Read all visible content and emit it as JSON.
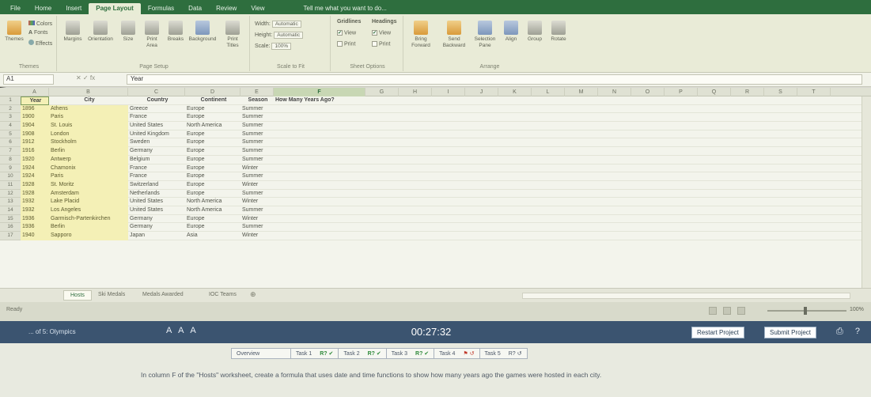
{
  "ribbon_tabs": [
    {
      "label": "File",
      "active": false
    },
    {
      "label": "Home",
      "active": false
    },
    {
      "label": "Insert",
      "active": false
    },
    {
      "label": "Page Layout",
      "active": true
    },
    {
      "label": "Formulas",
      "active": false
    },
    {
      "label": "Data",
      "active": false
    },
    {
      "label": "Review",
      "active": false
    },
    {
      "label": "View",
      "active": false
    }
  ],
  "tell_me": "Tell me what you want to do...",
  "ribbon": {
    "themes": {
      "themes_label": "Themes",
      "colors": "Colors",
      "fonts": "Fonts",
      "effects": "Effects",
      "group": "Themes"
    },
    "page_setup": {
      "margins": "Margins",
      "orientation": "Orientation",
      "size": "Size",
      "print_area": "Print Area",
      "breaks": "Breaks",
      "background": "Background",
      "print_titles": "Print Titles",
      "group": "Page Setup"
    },
    "scale": {
      "width_label": "Width:",
      "width_value": "Automatic",
      "height_label": "Height:",
      "height_value": "Automatic",
      "scale_label": "Scale:",
      "scale_value": "100%",
      "group": "Scale to Fit"
    },
    "sheet_options": {
      "gridlines": "Gridlines",
      "headings": "Headings",
      "view": "View",
      "print": "Print",
      "group": "Sheet Options"
    },
    "arrange": {
      "bring_forward": "Bring Forward",
      "send_backward": "Send Backward",
      "selection_pane": "Selection Pane",
      "align": "Align",
      "group_btn": "Group",
      "rotate": "Rotate",
      "group": "Arrange"
    }
  },
  "formula_bar": {
    "name_box": "A1",
    "content": "Year",
    "fx": "✕  ✓  fx"
  },
  "columns": [
    {
      "label": "A",
      "selected": false
    },
    {
      "label": "B",
      "selected": false
    },
    {
      "label": "C",
      "selected": false
    },
    {
      "label": "D",
      "selected": false
    },
    {
      "label": "E",
      "selected": false
    },
    {
      "label": "F",
      "selected": true
    },
    {
      "label": "G",
      "selected": false
    },
    {
      "label": "H",
      "selected": false
    },
    {
      "label": "I",
      "selected": false
    },
    {
      "label": "J",
      "selected": false
    },
    {
      "label": "K",
      "selected": false
    },
    {
      "label": "L",
      "selected": false
    },
    {
      "label": "M",
      "selected": false
    },
    {
      "label": "N",
      "selected": false
    },
    {
      "label": "O",
      "selected": false
    },
    {
      "label": "P",
      "selected": false
    },
    {
      "label": "Q",
      "selected": false
    },
    {
      "label": "R",
      "selected": false
    },
    {
      "label": "S",
      "selected": false
    },
    {
      "label": "T",
      "selected": false
    }
  ],
  "table": {
    "headers": [
      "Year",
      "City",
      "Country",
      "Continent",
      "Season",
      "How Many Years Ago?"
    ],
    "rows": [
      [
        "1896",
        "Athens",
        "Greece",
        "Europe",
        "Summer"
      ],
      [
        "1900",
        "Paris",
        "France",
        "Europe",
        "Summer"
      ],
      [
        "1904",
        "St. Louis",
        "United States",
        "North America",
        "Summer"
      ],
      [
        "1908",
        "London",
        "United Kingdom",
        "Europe",
        "Summer"
      ],
      [
        "1912",
        "Stockholm",
        "Sweden",
        "Europe",
        "Summer"
      ],
      [
        "1916",
        "Berlin",
        "Germany",
        "Europe",
        "Summer"
      ],
      [
        "1920",
        "Antwerp",
        "Belgium",
        "Europe",
        "Summer"
      ],
      [
        "1924",
        "Chamonix",
        "France",
        "Europe",
        "Winter"
      ],
      [
        "1924",
        "Paris",
        "France",
        "Europe",
        "Summer"
      ],
      [
        "1928",
        "St. Moritz",
        "Switzerland",
        "Europe",
        "Winter"
      ],
      [
        "1928",
        "Amsterdam",
        "Netherlands",
        "Europe",
        "Summer"
      ],
      [
        "1932",
        "Lake Placid",
        "United States",
        "North America",
        "Winter"
      ],
      [
        "1932",
        "Los Angeles",
        "United States",
        "North America",
        "Summer"
      ],
      [
        "1936",
        "Garmisch-Partenkirchen",
        "Germany",
        "Europe",
        "Winter"
      ],
      [
        "1936",
        "Berlin",
        "Germany",
        "Europe",
        "Summer"
      ],
      [
        "1940",
        "Sapporo",
        "Japan",
        "Asia",
        "Winter"
      ]
    ],
    "row_numbers": [
      "1",
      "2",
      "3",
      "4",
      "5",
      "6",
      "7",
      "8",
      "9",
      "10",
      "11",
      "12",
      "13",
      "14",
      "15",
      "16",
      "17"
    ]
  },
  "sheet_tabs": [
    {
      "label": "Hosts",
      "active": true
    },
    {
      "label": "Ski Medals",
      "active": false
    },
    {
      "label": "Medals Awarded",
      "active": false
    },
    {
      "label": "IOC Teams",
      "active": false
    }
  ],
  "status": {
    "ready": "Ready",
    "zoom": "100%"
  },
  "exam": {
    "title": "... of 5: Olympics",
    "font_sizes": "A A A",
    "timer": "00:27:32",
    "restart": "Restart Project",
    "submit": "Submit Project",
    "help_icons": "⎙ ?"
  },
  "task_nav": [
    {
      "label": "Overview",
      "mark": "",
      "state": "none"
    },
    {
      "label": "Task 1",
      "mark": "R? ✔",
      "state": "ok"
    },
    {
      "label": "Task 2",
      "mark": "R? ✔",
      "state": "ok"
    },
    {
      "label": "Task 3",
      "mark": "R? ✔",
      "state": "ok"
    },
    {
      "label": "Task 4",
      "mark": "⚑ ↺",
      "state": "flag"
    },
    {
      "label": "Task 5",
      "mark": "R? ↺",
      "state": "none"
    }
  ],
  "task_text": "In column F of the \"Hosts\" worksheet, create a formula that uses date and time functions to show how many years ago the games were hosted in each city."
}
